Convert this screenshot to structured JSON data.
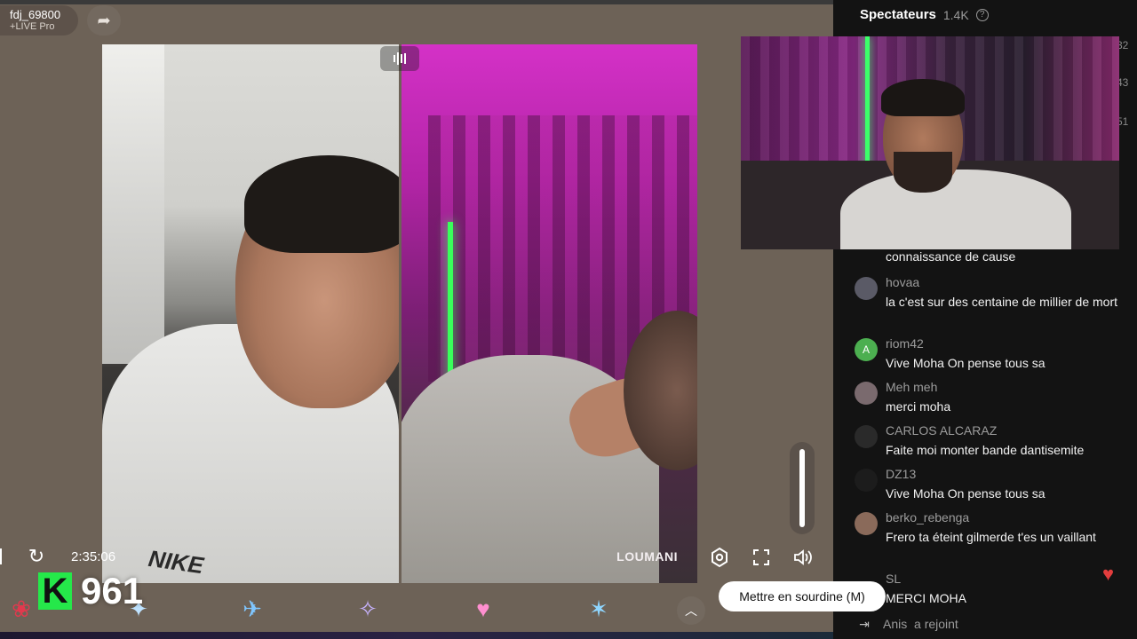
{
  "stream": {
    "streamer_name": "fdj_69800",
    "streamer_sub": "LIVE Pro",
    "elapsed": "2:35:06",
    "right_video_label": "LOUMANI",
    "left_video_brand": "NIKE"
  },
  "counter": {
    "badge": "K",
    "value": "961"
  },
  "tooltip": "Mettre en sourdine (M)",
  "volume_level": 1.0,
  "sidebar": {
    "title": "Spectateurs",
    "count": "1.4K",
    "side_nums": [
      "32",
      "43",
      "51"
    ],
    "previous_text": "connaissance de cause",
    "messages": [
      {
        "user": "hovaa",
        "text": "la c'est sur des centaine de millier de mort",
        "avatar": "",
        "avatar_color": "#5a5a66"
      },
      {
        "user": "riom42",
        "text": "Vive Moha On pense tous sa",
        "avatar": "A",
        "avatar_color": "#4caf50"
      },
      {
        "user": "Meh meh",
        "text": "merci moha",
        "avatar": "",
        "avatar_color": "#7a6a6e"
      },
      {
        "user": "CARLOS ALCARAZ",
        "text": "Faite moi monter bande dantisemite",
        "avatar": "",
        "avatar_color": "#2a2a2a"
      },
      {
        "user": "DZ13",
        "text": "Vive Moha On pense tous sa",
        "avatar": "",
        "avatar_color": "#1c1c1c"
      },
      {
        "user": "berko_rebenga",
        "text": "Frero ta éteint gilmerde t'es un vaillant",
        "avatar": "",
        "avatar_color": "#8a6a5a"
      },
      {
        "user": "SL",
        "text": "MERCI MOHA",
        "avatar": "",
        "avatar_color": "#3b3b3b"
      }
    ],
    "join": {
      "user": "Anis",
      "action": "a rejoint"
    }
  },
  "icons": {
    "share": "share-arrow-icon",
    "reload": "reload-icon",
    "settings": "gear-icon",
    "fullscreen": "fullscreen-icon",
    "volume": "speaker-icon",
    "help": "question-icon",
    "heart": "heart-icon"
  },
  "colors": {
    "counter_badge": "#25e84a",
    "sidebar_bg": "#131313",
    "page_bg": "#6d6257",
    "heart": "#e23d3d"
  }
}
